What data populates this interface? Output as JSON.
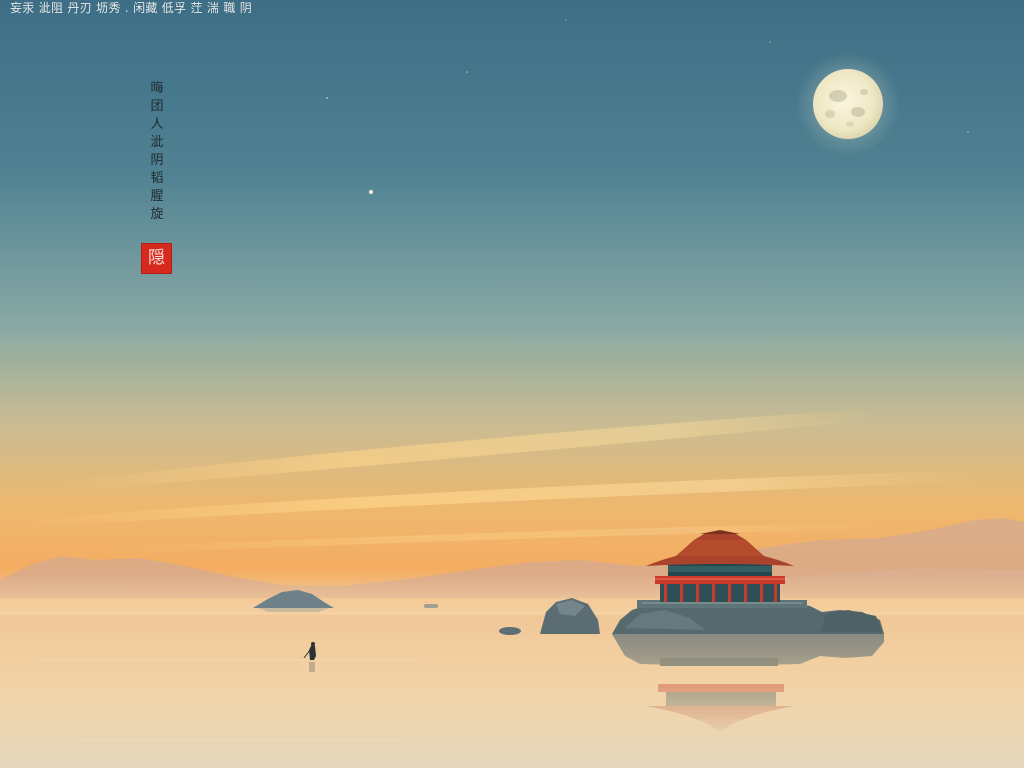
{
  "caption": "妄汞 泚阻 丹刃 坜秀 . 闲藏 低孚 茳 湍 職 阴",
  "poem": [
    "晦",
    "团",
    "人",
    "泚",
    "阴",
    "韬",
    "腥",
    "旋"
  ],
  "seal": {
    "text": "隠",
    "color": "#d62a1e"
  },
  "palette": {
    "sky_top": "#3f6f86",
    "sky_mid": "#7ea3a6",
    "horizon": "#f2b062",
    "water": "#f1cf9c",
    "roof": "#b0482f",
    "pillar": "#c7372a"
  }
}
